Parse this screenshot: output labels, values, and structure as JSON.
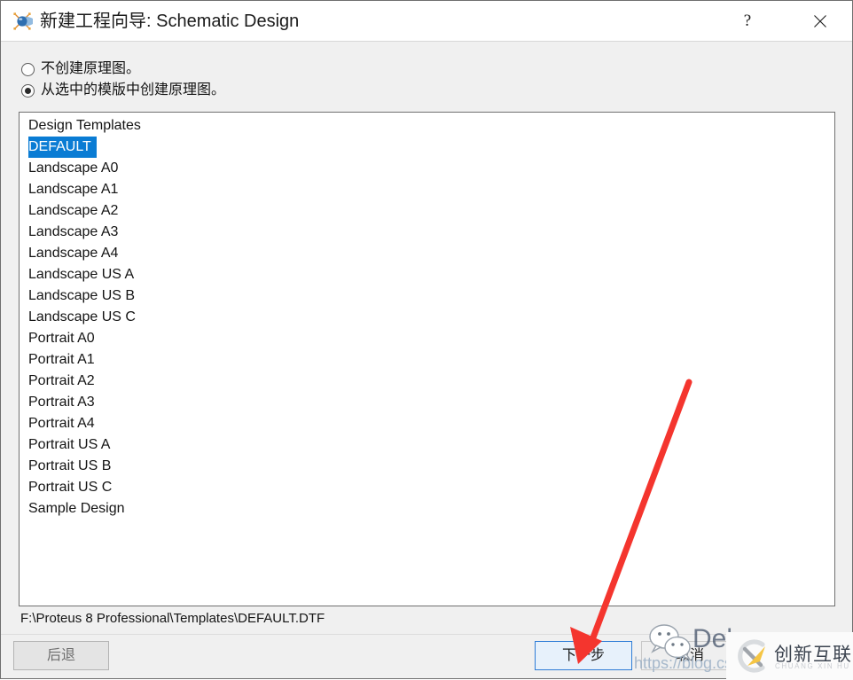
{
  "window": {
    "title": "新建工程向导: Schematic Design",
    "icon": "proteus-globe-icon",
    "help_label": "?",
    "close_label": "✕"
  },
  "options": {
    "none": {
      "label": "不创建原理图。",
      "selected": false
    },
    "from_template": {
      "label": "从选中的模版中创建原理图。",
      "selected": true
    }
  },
  "templates": {
    "header": "Design Templates",
    "selected": "DEFAULT",
    "items": [
      "DEFAULT",
      "Landscape A0",
      "Landscape A1",
      "Landscape A2",
      "Landscape A3",
      "Landscape A4",
      "Landscape US A",
      "Landscape US B",
      "Landscape US C",
      "Portrait A0",
      "Portrait A1",
      "Portrait A2",
      "Portrait A3",
      "Portrait A4",
      "Portrait US A",
      "Portrait US B",
      "Portrait US C",
      "Sample Design"
    ]
  },
  "path": "F:\\Proteus 8 Professional\\Templates\\DEFAULT.DTF",
  "buttons": {
    "back": "后退",
    "next": "下一步",
    "cancel": "取消"
  },
  "colors": {
    "selection_blue": "#0a7cd4",
    "focus_border": "#2e7cd6",
    "focus_fill": "#e7f1fb",
    "dialog_background": "#f0f0f0",
    "annotation_red": "#f4352e",
    "brand_yellow": "#f5c544"
  },
  "watermarks": {
    "nickname": "Deb",
    "url": "https://blog.csd",
    "brand_name": "创新互联",
    "brand_pinyin": "CHUANG XIN HU LIAN",
    "wechat_icon": "wechat-icon",
    "brand_icon": "brand-x-icon"
  },
  "annotation": {
    "type": "arrow",
    "points_to": "下一步"
  }
}
